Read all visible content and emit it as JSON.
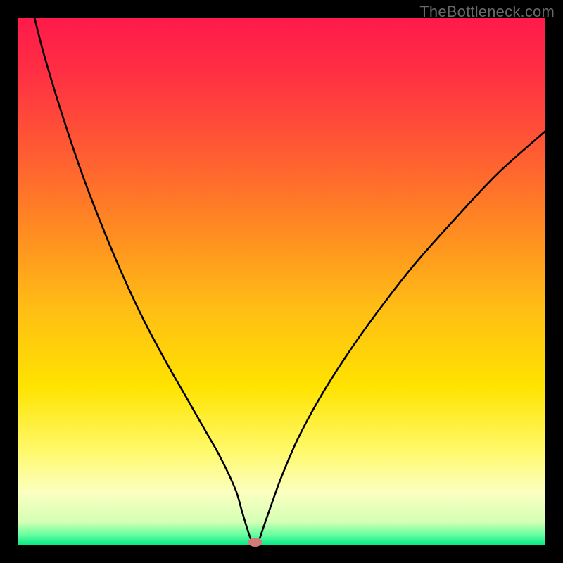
{
  "watermark": "TheBottleneck.com",
  "chart_data": {
    "type": "line",
    "title": "",
    "xlabel": "",
    "ylabel": "",
    "xlim": [
      0,
      100
    ],
    "ylim": [
      0,
      100
    ],
    "border_thickness_px": 25,
    "gradient_stops": [
      {
        "offset": 0.0,
        "color": "#ff1a4a"
      },
      {
        "offset": 0.1,
        "color": "#ff2e44"
      },
      {
        "offset": 0.25,
        "color": "#ff5a33"
      },
      {
        "offset": 0.4,
        "color": "#ff8a22"
      },
      {
        "offset": 0.55,
        "color": "#ffbd15"
      },
      {
        "offset": 0.7,
        "color": "#ffe300"
      },
      {
        "offset": 0.82,
        "color": "#fff96a"
      },
      {
        "offset": 0.9,
        "color": "#fbffc0"
      },
      {
        "offset": 0.955,
        "color": "#d5ffb5"
      },
      {
        "offset": 0.98,
        "color": "#66ff9e"
      },
      {
        "offset": 1.0,
        "color": "#00e884"
      }
    ],
    "curve": {
      "description": "V-shaped bottleneck curve with deep minimum",
      "x": [
        3.2,
        5,
        8,
        12,
        16,
        20,
        24,
        28,
        32,
        36,
        38,
        40,
        41.5,
        42.5,
        43.5,
        44.2,
        45,
        45.8,
        46.5,
        48,
        50,
        53,
        57,
        62,
        68,
        75,
        83,
        91,
        100
      ],
      "y": [
        100,
        93,
        83,
        71,
        60.5,
        51,
        42.5,
        35,
        28,
        21,
        17.5,
        13.5,
        10,
        6.5,
        3.2,
        1.2,
        0.3,
        1.2,
        3.2,
        7.5,
        13,
        20,
        27.5,
        35.5,
        44,
        53,
        62,
        70.5,
        78.5
      ]
    },
    "minimum_marker": {
      "x": 45,
      "y": 0.6,
      "color": "#d07d7a"
    }
  }
}
